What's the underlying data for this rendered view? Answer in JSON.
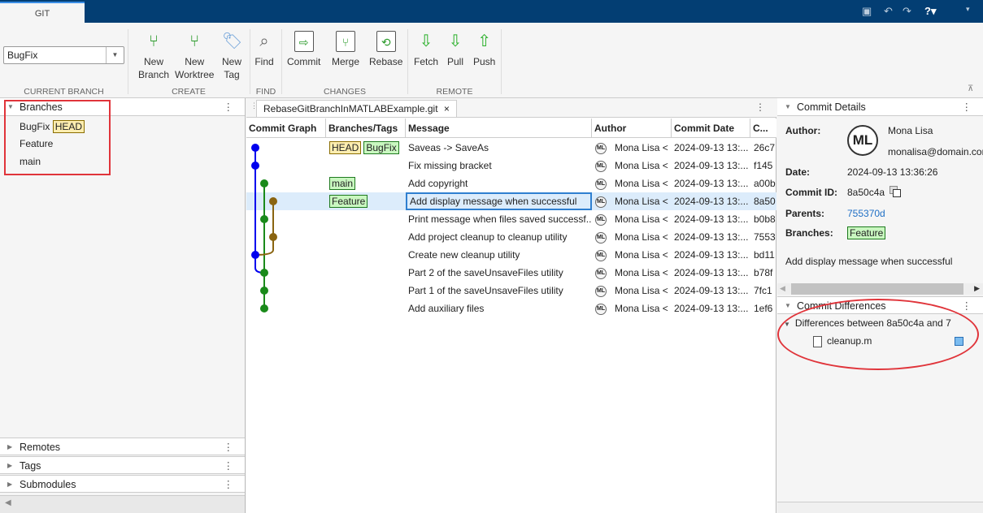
{
  "app": {
    "tab": "GIT"
  },
  "toolbar": {
    "current_branch": "BugFix",
    "current_branch_label": "CURRENT BRANCH",
    "create_label": "CREATE",
    "find_label": "FIND",
    "changes_label": "CHANGES",
    "remote_label": "REMOTE",
    "buttons": [
      {
        "id": "new-branch",
        "l1": "New",
        "l2": "Branch"
      },
      {
        "id": "new-worktree",
        "l1": "New",
        "l2": "Worktree"
      },
      {
        "id": "new-tag",
        "l1": "New",
        "l2": "Tag"
      },
      {
        "id": "find",
        "l1": "Find",
        "l2": ""
      },
      {
        "id": "commit",
        "l1": "Commit",
        "l2": ""
      },
      {
        "id": "merge",
        "l1": "Merge",
        "l2": ""
      },
      {
        "id": "rebase",
        "l1": "Rebase",
        "l2": ""
      },
      {
        "id": "fetch",
        "l1": "Fetch",
        "l2": ""
      },
      {
        "id": "pull",
        "l1": "Pull",
        "l2": ""
      },
      {
        "id": "push",
        "l1": "Push",
        "l2": ""
      }
    ]
  },
  "left": {
    "branches_title": "Branches",
    "branches": [
      {
        "name": "BugFix",
        "badge": "HEAD"
      },
      {
        "name": "Feature"
      },
      {
        "name": "main"
      }
    ],
    "remotes": "Remotes",
    "tags": "Tags",
    "submodules": "Submodules"
  },
  "center": {
    "tab": "RebaseGitBranchInMATLABExample.git",
    "columns": [
      "Commit Graph",
      "Branches/Tags",
      "Message",
      "Author",
      "Commit Date",
      "C..."
    ],
    "rows": [
      {
        "tags": [
          "HEAD",
          "BugFix"
        ],
        "message": "Saveas -> SaveAs",
        "author": "Mona Lisa <",
        "date": "2024-09-13 13:...",
        "id": "26c7",
        "lane": 0,
        "color": "#0000ee"
      },
      {
        "tags": [],
        "message": "Fix missing bracket",
        "author": "Mona Lisa <",
        "date": "2024-09-13 13:...",
        "id": "f145",
        "lane": 0,
        "color": "#0000ee"
      },
      {
        "tags": [
          "main"
        ],
        "message": "Add copyright",
        "author": "Mona Lisa <",
        "date": "2024-09-13 13:...",
        "id": "a00b",
        "lane": 1,
        "color": "#1a8a1a"
      },
      {
        "tags": [
          "Feature"
        ],
        "message": "Add display message when successful",
        "author": "Mona Lisa <",
        "date": "2024-09-13 13:...",
        "id": "8a50",
        "lane": 2,
        "color": "#8a6410",
        "selected": true
      },
      {
        "tags": [],
        "message": "Print message when files saved successf...",
        "author": "Mona Lisa <",
        "date": "2024-09-13 13:...",
        "id": "b0b8",
        "lane": 1,
        "color": "#1a8a1a"
      },
      {
        "tags": [],
        "message": "Add project cleanup to cleanup utility",
        "author": "Mona Lisa <",
        "date": "2024-09-13 13:...",
        "id": "7553",
        "lane": 2,
        "color": "#8a6410"
      },
      {
        "tags": [],
        "message": "Create new cleanup utility",
        "author": "Mona Lisa <",
        "date": "2024-09-13 13:...",
        "id": "bd11",
        "lane": 0,
        "color": "#0000ee"
      },
      {
        "tags": [],
        "message": "Part 2 of the saveUnsaveFiles utility",
        "author": "Mona Lisa <",
        "date": "2024-09-13 13:...",
        "id": "b78f",
        "lane": 1,
        "color": "#1a8a1a"
      },
      {
        "tags": [],
        "message": "Part 1 of the saveUnsaveFiles utility",
        "author": "Mona Lisa <",
        "date": "2024-09-13 13:...",
        "id": "7fc1",
        "lane": 1,
        "color": "#1a8a1a"
      },
      {
        "tags": [],
        "message": "Add auxiliary files",
        "author": "Mona Lisa <",
        "date": "2024-09-13 13:...",
        "id": "1ef6",
        "lane": 1,
        "color": "#1a8a1a"
      }
    ],
    "avatar": "ML"
  },
  "details": {
    "title": "Commit Details",
    "author_label": "Author:",
    "author_name": "Mona Lisa",
    "author_email": "monalisa@domain.com",
    "avatar": "ML",
    "date_label": "Date:",
    "date": "2024-09-13 13:36:26",
    "id_label": "Commit ID:",
    "id": "8a50c4a",
    "parents_label": "Parents:",
    "parents": "755370d",
    "branches_label": "Branches:",
    "branch": "Feature",
    "message": "Add display message when successful"
  },
  "differences": {
    "title": "Commit Differences",
    "group": "Differences between 8a50c4a and 7",
    "file": "cleanup.m"
  }
}
